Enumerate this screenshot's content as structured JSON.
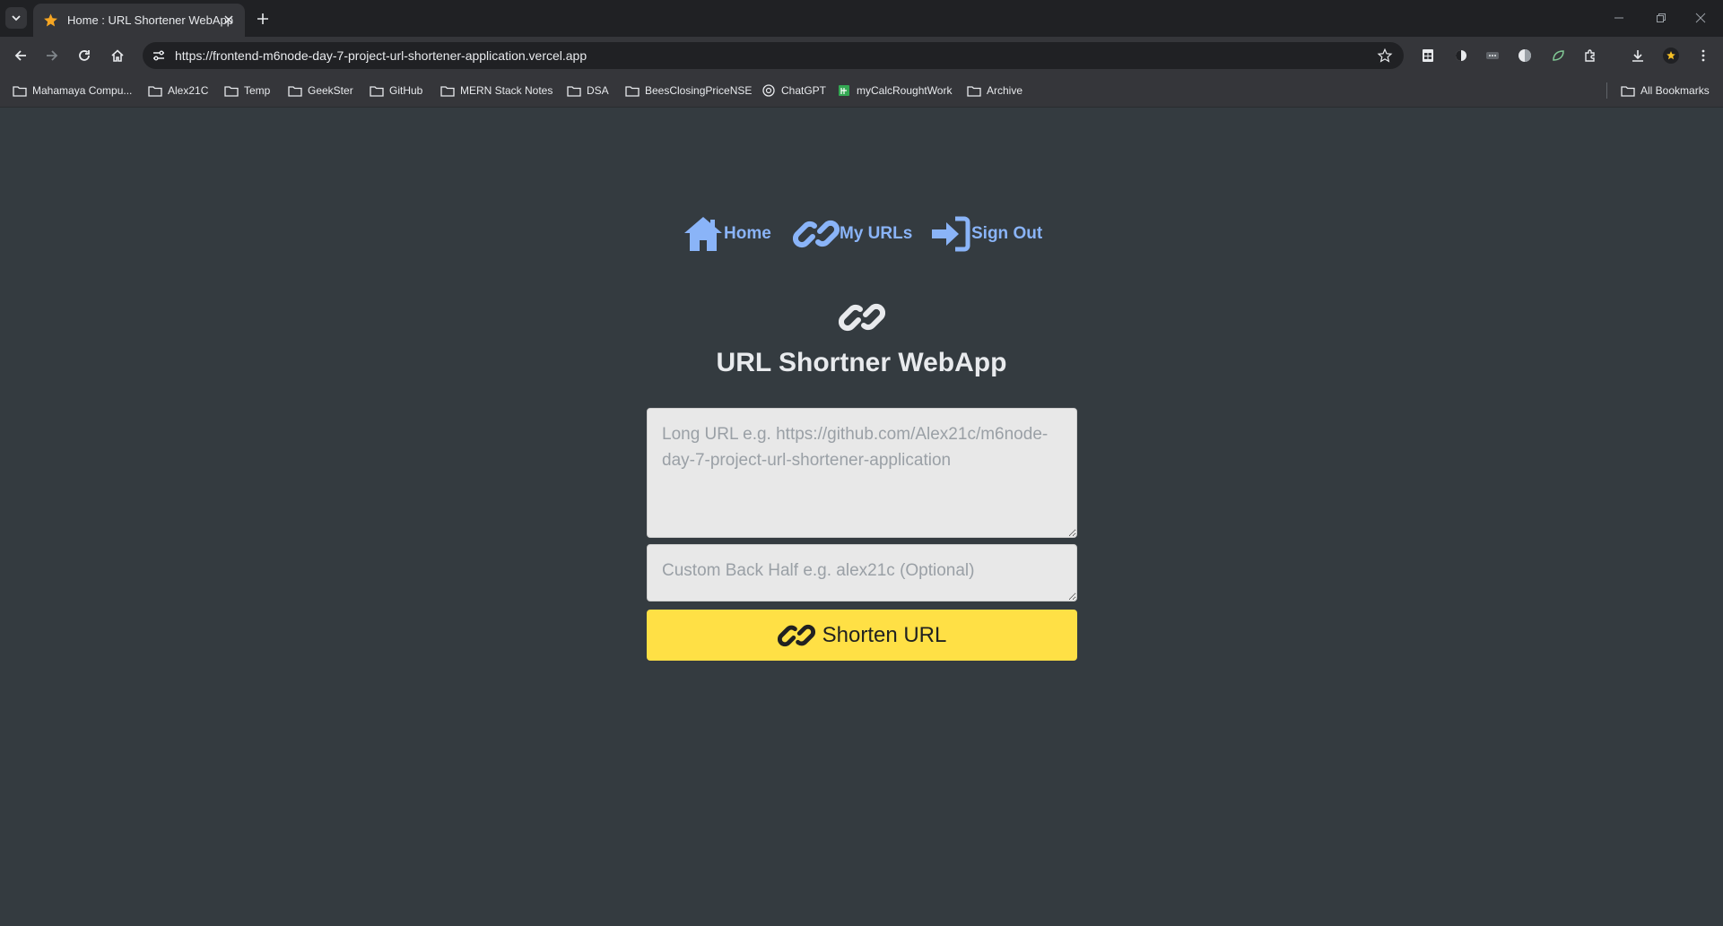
{
  "browser": {
    "tab_title": "Home : URL Shortener WebApp",
    "url": "https://frontend-m6node-day-7-project-url-shortener-application.vercel.app",
    "bookmarks": [
      {
        "label": "Mahamaya Compu...",
        "icon": "folder-icon"
      },
      {
        "label": "Alex21C",
        "icon": "folder-icon"
      },
      {
        "label": "Temp",
        "icon": "folder-icon"
      },
      {
        "label": "GeekSter",
        "icon": "folder-icon"
      },
      {
        "label": "GitHub",
        "icon": "folder-icon"
      },
      {
        "label": "MERN Stack Notes",
        "icon": "folder-icon"
      },
      {
        "label": "DSA",
        "icon": "folder-icon"
      },
      {
        "label": "BeesClosingPriceNSE",
        "icon": "folder-icon"
      },
      {
        "label": "ChatGPT",
        "icon": "chatgpt-icon"
      },
      {
        "label": "myCalcRoughtWork",
        "icon": "sheets-icon"
      },
      {
        "label": "Archive",
        "icon": "folder-icon"
      }
    ],
    "all_bookmarks": "All Bookmarks"
  },
  "nav": {
    "home": "Home",
    "my_urls": "My URLs",
    "sign_out": "Sign Out"
  },
  "app": {
    "title": "URL Shortner WebApp"
  },
  "form": {
    "long_url_placeholder": "Long URL e.g. https://github.com/Alex21c/m6node-day-7-project-url-shortener-application",
    "back_half_placeholder": "Custom Back Half e.g. alex21c (Optional)",
    "submit_label": "Shorten URL"
  },
  "colors": {
    "page_background": "#343b40",
    "nav_link": "#8ab4f8",
    "button_background": "#ffe045",
    "field_background": "#e8e8e8"
  }
}
